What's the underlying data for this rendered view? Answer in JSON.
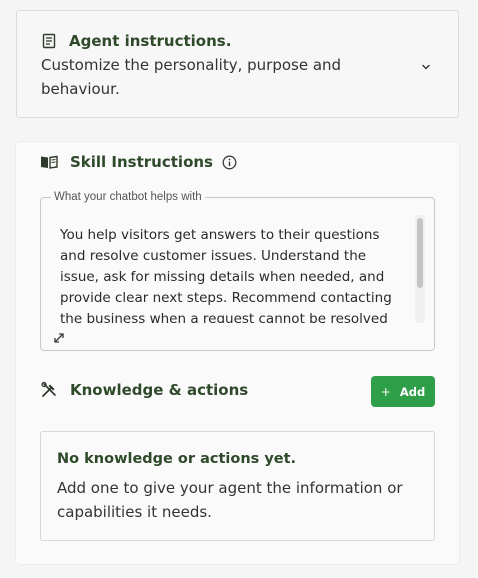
{
  "agent_instructions": {
    "title": "Agent instructions.",
    "description": "Customize the personality, purpose and behaviour.",
    "icon": "document-icon",
    "toggle_icon": "chevron-down-icon"
  },
  "skill_instructions": {
    "title": "Skill Instructions",
    "icon": "open-book-icon",
    "info_icon": "info-icon",
    "prompt_label": "What your chatbot helps with",
    "prompt_value": "You help visitors get answers to their questions and resolve customer issues. Understand the issue, ask for missing details when needed, and provide clear next steps. Recommend contacting the business when a request cannot be resolved"
  },
  "knowledge_actions": {
    "title": "Knowledge & actions",
    "icon": "tools-icon",
    "add_label": "Add",
    "empty_title": "No knowledge or actions yet.",
    "empty_description": "Add one to give your agent the information or capabilities it needs."
  },
  "colors": {
    "heading": "#2f4a2a",
    "accent": "#2e9e48",
    "background": "#f5f5f5"
  }
}
